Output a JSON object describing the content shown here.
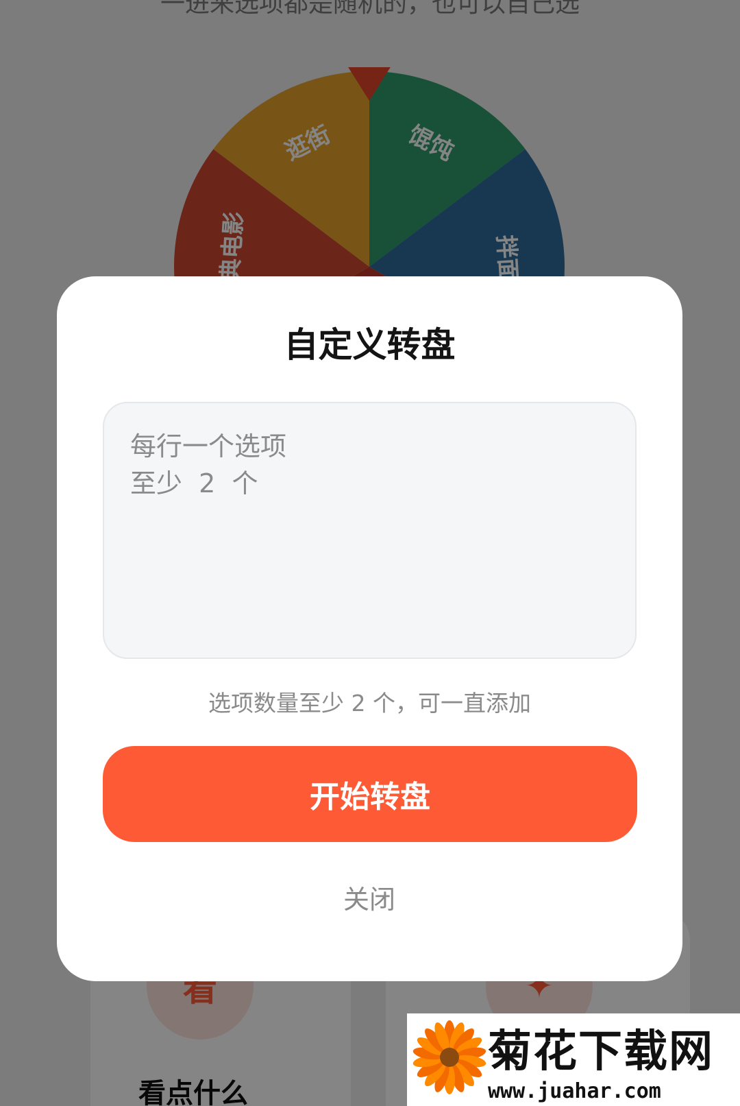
{
  "background": {
    "subtitle": "一进来选项都是随机的，也可以自己选",
    "wheel": {
      "segments": [
        {
          "label": "馄饨",
          "color": "#2f9b6b"
        },
        {
          "label": "拌面",
          "color": "#2f6a9c"
        },
        {
          "label": "经典电影",
          "color": "#d04a30"
        },
        {
          "label": "逛街",
          "color": "#e8a12c"
        }
      ],
      "pointer_color": "#e0462a"
    },
    "cards": [
      {
        "icon_char": "看",
        "label": "看点什么"
      },
      {
        "icon_char": "✦",
        "label": ""
      }
    ]
  },
  "modal": {
    "title": "自定义转盘",
    "input_placeholder": "每行一个选项\n至少  2  个",
    "input_value": "",
    "hint": "选项数量至少 2 个，可一直添加",
    "start_button_label": "开始转盘",
    "close_button_label": "关闭"
  },
  "watermark": {
    "title": "菊花下载网",
    "url": "www.juahar.com"
  },
  "colors": {
    "accent": "#ff5a36",
    "scrim": "rgba(0,0,0,0.48)",
    "modal_bg": "#ffffff",
    "input_bg": "#f5f6f8"
  }
}
